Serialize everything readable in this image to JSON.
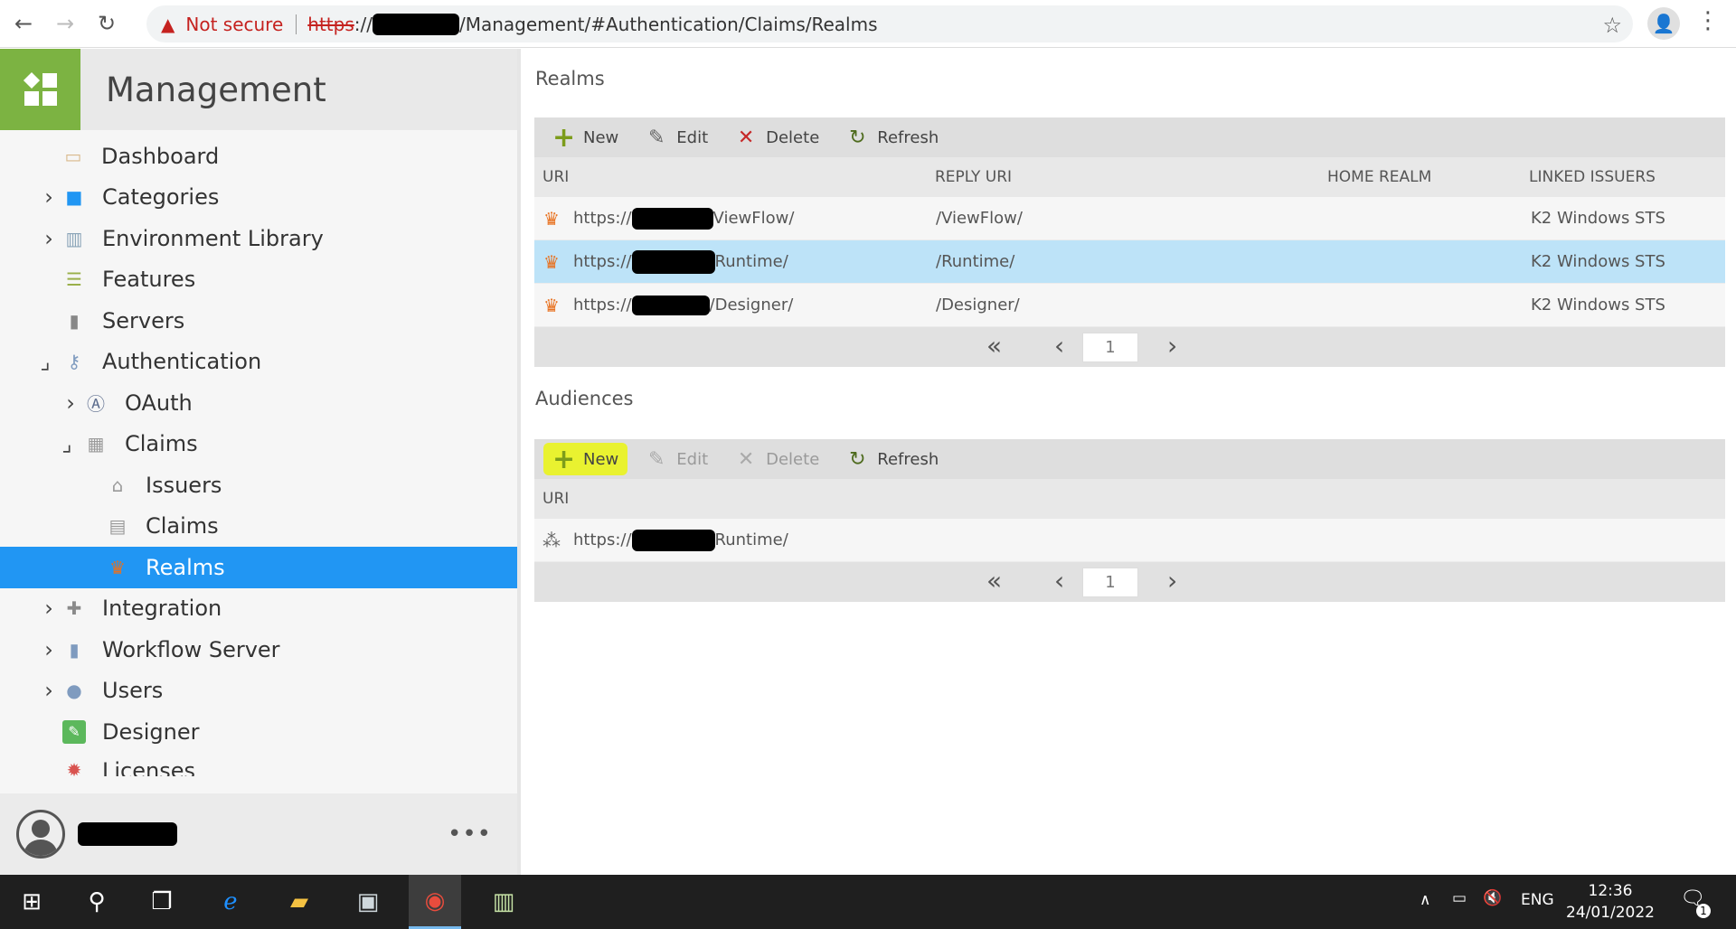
{
  "browser": {
    "back_icon": "arrow-left-icon",
    "forward_icon": "arrow-right-icon",
    "reload_icon": "reload-icon",
    "not_secure": "Not secure",
    "url_scheme": "https",
    "url_sep": "://",
    "url_path": "/Management/#Authentication/Claims/Realms"
  },
  "sidebar": {
    "app_title": "Management",
    "items": [
      {
        "label": "Dashboard"
      },
      {
        "label": "Categories"
      },
      {
        "label": "Environment Library"
      },
      {
        "label": "Features"
      },
      {
        "label": "Servers"
      },
      {
        "label": "Authentication"
      },
      {
        "label": "OAuth"
      },
      {
        "label": "Claims"
      },
      {
        "label": "Issuers"
      },
      {
        "label": "Claims"
      },
      {
        "label": "Realms"
      },
      {
        "label": "Integration"
      },
      {
        "label": "Workflow Server"
      },
      {
        "label": "Users"
      },
      {
        "label": "Designer"
      },
      {
        "label": "Licenses"
      }
    ],
    "more_label": "•••"
  },
  "realms": {
    "title": "Realms",
    "toolbar": {
      "new": "New",
      "edit": "Edit",
      "delete": "Delete",
      "refresh": "Refresh"
    },
    "columns": [
      "URI",
      "REPLY URI",
      "HOME REALM",
      "LINKED ISSUERS"
    ],
    "rows": [
      {
        "uri_prefix": "https://",
        "uri_suffix": "ViewFlow/",
        "reply_uri": "/ViewFlow/",
        "home_realm": "",
        "linked_issuers": "K2 Windows STS"
      },
      {
        "uri_prefix": "https://",
        "uri_suffix": "Runtime/",
        "reply_uri": "/Runtime/",
        "home_realm": "",
        "linked_issuers": "K2 Windows STS"
      },
      {
        "uri_prefix": "https://",
        "uri_suffix": "/Designer/",
        "reply_uri": "/Designer/",
        "home_realm": "",
        "linked_issuers": "K2 Windows STS"
      }
    ],
    "page": "1"
  },
  "audiences": {
    "title": "Audiences",
    "toolbar": {
      "new": "New",
      "edit": "Edit",
      "delete": "Delete",
      "refresh": "Refresh"
    },
    "columns": [
      "URI"
    ],
    "rows": [
      {
        "uri_prefix": "https://",
        "uri_suffix": "Runtime/"
      }
    ],
    "page": "1"
  },
  "taskbar": {
    "language": "ENG",
    "time": "12:36",
    "date": "24/01/2022",
    "notification_count": "1"
  },
  "colors": {
    "brand_green": "#7cb342",
    "selection_blue": "#2196f3",
    "row_selected": "#bde3f8",
    "highlight_yellow": "#e9f230",
    "crown_orange": "#e8711f"
  }
}
